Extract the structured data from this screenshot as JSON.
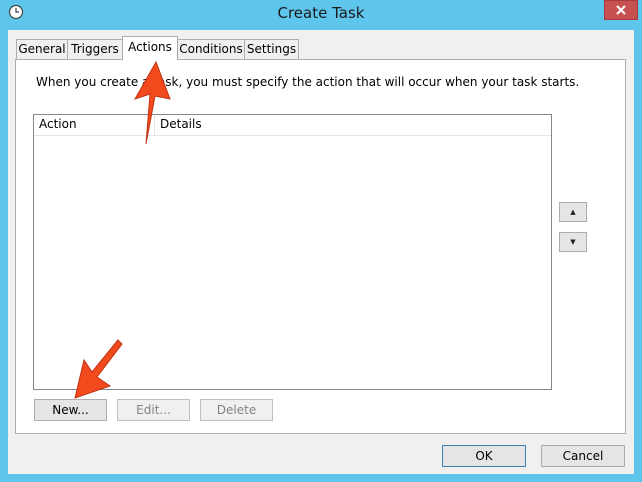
{
  "window": {
    "title": "Create Task"
  },
  "tabs": [
    {
      "label": "General"
    },
    {
      "label": "Triggers"
    },
    {
      "label": "Actions"
    },
    {
      "label": "Conditions"
    },
    {
      "label": "Settings"
    }
  ],
  "actions": {
    "intro_text": "When you create a task, you must specify the action that will occur when your task starts.",
    "list": {
      "columns": [
        "Action",
        "Details"
      ],
      "rows": []
    },
    "move_up": "▲",
    "move_down": "▼",
    "buttons": {
      "new": "New...",
      "edit": "Edit...",
      "delete": "Delete"
    }
  },
  "footer": {
    "ok": "OK",
    "cancel": "Cancel"
  },
  "colors": {
    "window_frame": "#5ec5ec",
    "close_button": "#c75050",
    "annotation_arrow": "#f24a1d"
  },
  "icons": {
    "title": "clock-icon",
    "close": "close-icon",
    "annotation": "red-arrow-icon"
  }
}
